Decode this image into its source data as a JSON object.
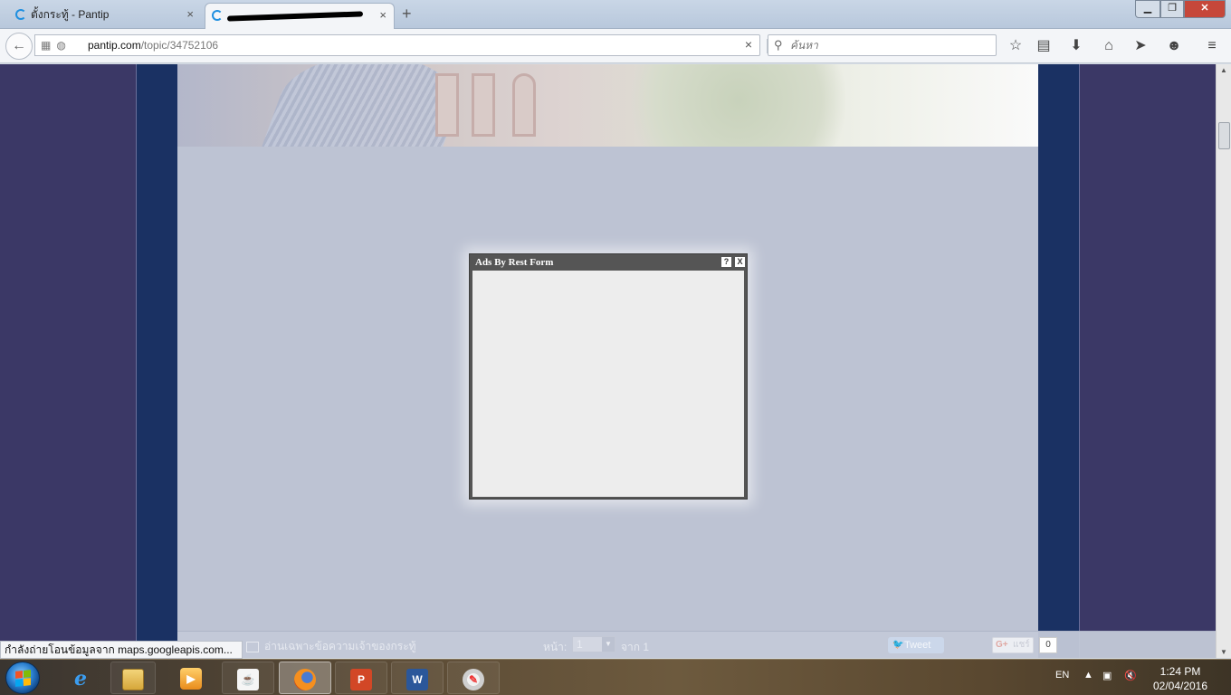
{
  "browser": {
    "tabs": [
      {
        "title": "ตั้งกระทู้ - Pantip",
        "loading": true
      },
      {
        "title": "",
        "loading": true,
        "redacted": true
      }
    ],
    "new_tab": "+",
    "close_glyph": "×",
    "url_domain": "pantip.com",
    "url_path": "/topic/34752106",
    "search_placeholder": "ค้นหา",
    "toolbar_icons": [
      "star-icon",
      "reading-list-icon",
      "download-icon",
      "home-icon",
      "send-icon",
      "chat-icon",
      "menu-icon"
    ],
    "window_controls": {
      "minimize": "▁",
      "maximize": "❐",
      "close": "✕"
    }
  },
  "popup": {
    "title": "Ads By Rest Form",
    "help": "?",
    "close": "X"
  },
  "bottom_bar": {
    "owner_only": "อ่านเฉพาะข้อความเจ้าของกระทู้",
    "page_label": "หน้า:",
    "page_value": "1",
    "of_label": "จาก 1",
    "tweet": "Tweet",
    "share": "แชร์",
    "share_count": "0"
  },
  "status_text": "กำลังถ่ายโอนข้อมูลจาก maps.googleapis.com...",
  "taskbar": {
    "apps": [
      "internet-explorer",
      "windows-explorer",
      "media-player",
      "java",
      "firefox",
      "powerpoint",
      "word",
      "paint"
    ],
    "language": "EN",
    "time": "1:24 PM",
    "date": "02/04/2016"
  },
  "colors": {
    "page_bg": "#3b3866",
    "side_columns": "#1a3163",
    "overlay": "#bdc3d3",
    "popup_frame": "#555555"
  }
}
